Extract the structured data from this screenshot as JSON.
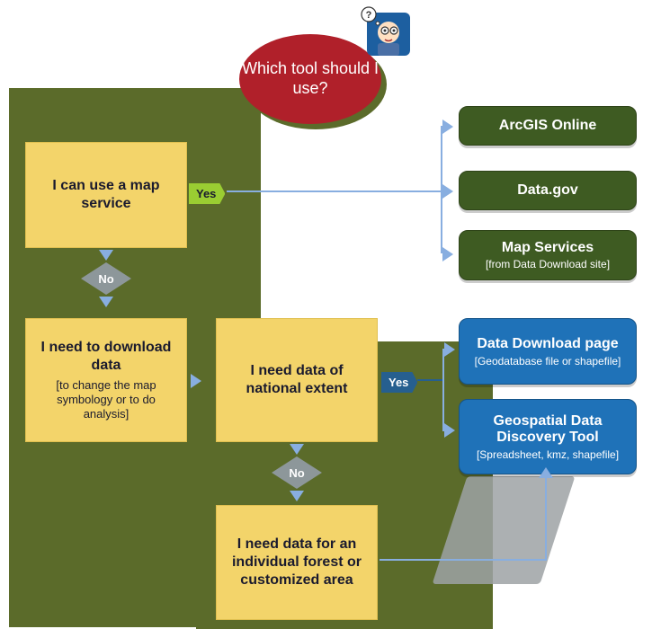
{
  "title": "Which tool should I use?",
  "decisions": {
    "map_service": {
      "text": "I can use a map service"
    },
    "download_data": {
      "text": "I need to download data",
      "sub": "[to change the map symbology or to do analysis]"
    },
    "national_extent": {
      "text": "I need data of national extent"
    },
    "individual_forest": {
      "text": "I need data for an individual forest or customized area"
    }
  },
  "labels": {
    "yes": "Yes",
    "no": "No"
  },
  "tools": {
    "arcgis": {
      "text": "ArcGIS Online"
    },
    "datagov": {
      "text": "Data.gov"
    },
    "mapservices": {
      "text": "Map Services",
      "sub": "[from Data Download site]"
    },
    "datadownload": {
      "text": "Data Download page",
      "sub": "[Geodatabase file or shapefile]"
    },
    "discovery": {
      "text": "Geospatial Data Discovery Tool",
      "sub": "[Spreadsheet, kmz,  shapefile]"
    }
  },
  "icons": {
    "thinker": "person-thinking-icon"
  }
}
